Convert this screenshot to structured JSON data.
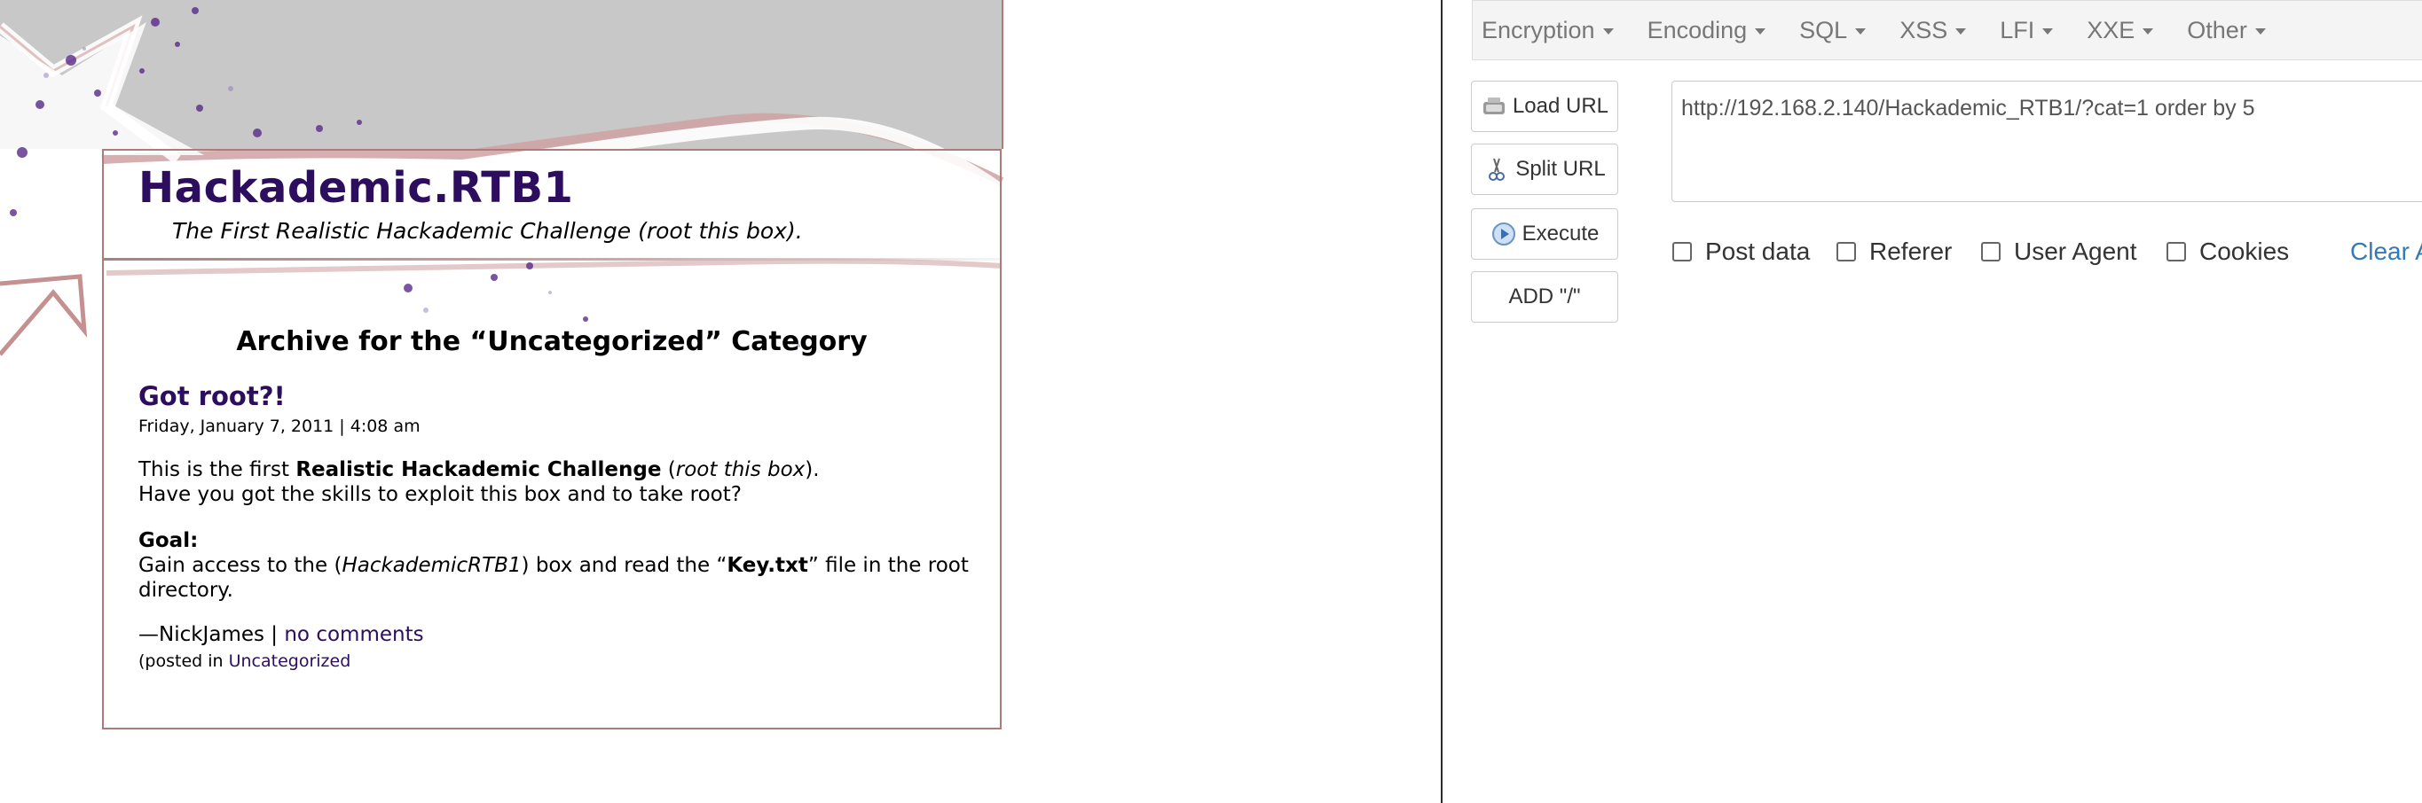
{
  "blog": {
    "site_title": "Hackademic.RTB1",
    "tagline": "The First Realistic Hackademic Challenge (root this box).",
    "archive_heading": "Archive for the “Uncategorized” Category",
    "post": {
      "title": "Got root?!",
      "date": "Friday, January 7, 2011 | 4:08 am",
      "para1_prefix": "This is the first ",
      "para1_bold": "Realistic Hackademic Challenge",
      "para1_mid": " (",
      "para1_italic": "root this box",
      "para1_suffix": ").",
      "para1_line2": "Have you got the skills to exploit this box and to take root?",
      "goal_label": "Goal:",
      "goal_prefix": "Gain access to the (",
      "goal_italic": "HackademicRTB1",
      "goal_mid": ") box and read the “",
      "goal_bold": "Key.txt",
      "goal_suffix": "” file in the root directory.",
      "author": "—NickJames | ",
      "comments_link": "no comments",
      "posted_in": "(posted in ",
      "category_link": "Uncategorized"
    }
  },
  "hackbar": {
    "menu": [
      {
        "label": "Encryption"
      },
      {
        "label": "Encoding"
      },
      {
        "label": "SQL"
      },
      {
        "label": "XSS"
      },
      {
        "label": "LFI"
      },
      {
        "label": "XXE"
      },
      {
        "label": "Other"
      }
    ],
    "buttons": {
      "load_url": "Load URL",
      "split_url": "Split URL",
      "execute": "Execute",
      "add_slash": "ADD \"/\""
    },
    "url_value": "http://192.168.2.140/Hackademic_RTB1/?cat=1 order by 5",
    "options": {
      "post_data": "Post data",
      "referer": "Referer",
      "user_agent": "User Agent",
      "cookies": "Cookies"
    },
    "clear_all": "Clear All",
    "colors": {
      "link_blue": "#337ab7",
      "menu_gray": "#777777"
    }
  },
  "icons": {
    "load": "load-url-icon",
    "split": "scissors-icon",
    "execute": "play-icon",
    "caret": "caret-down-icon"
  }
}
